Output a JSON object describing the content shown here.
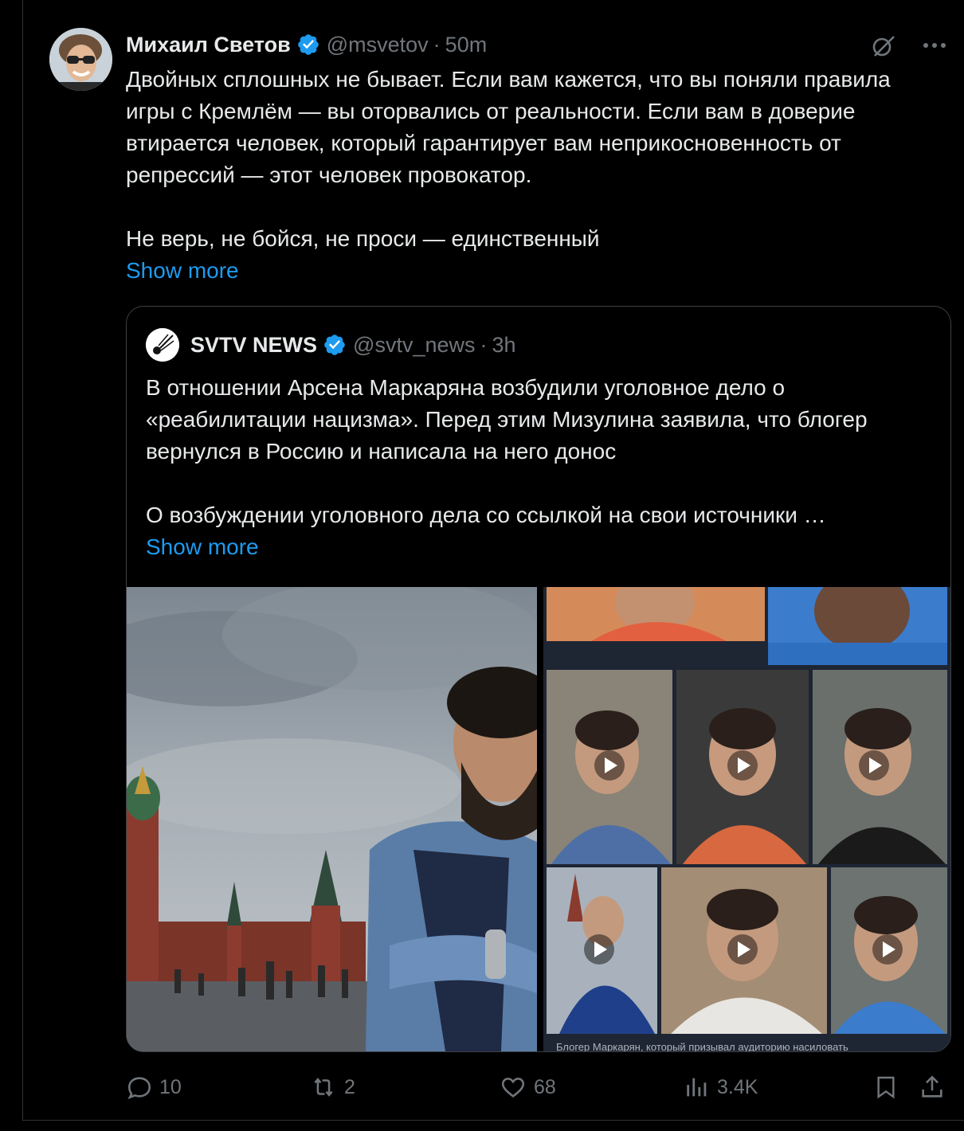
{
  "tweet": {
    "author_name": "Михаил Светов",
    "author_handle": "@msvetov",
    "separator": "·",
    "time": "50m",
    "text": "Двойных сплошных не бывает. Если вам кажется, что вы поняли правила игры с Кремлём — вы оторвались от реальности. Если вам в доверие втирается человек, который гарантирует вам неприкосновенность от репрессий — этот человек провокатор.\n\nНе верь, не бойся, не проси — единственный",
    "show_more": "Show more",
    "icons": [
      "grok-icon",
      "more-icon"
    ]
  },
  "quote": {
    "author_name": "SVTV NEWS",
    "author_handle": "@svtv_news",
    "separator": "·",
    "time": "3h",
    "text": "В отношении Арсена Маркаряна возбудили уголовное дело о «реабилитации нацизма». Перед этим Мизулина заявила, что блогер вернулся в Россию и написала на него донос\n\nО возбуждении уголовного дела со ссылкой на свои источники …",
    "show_more": "Show more",
    "collage_caption": "Блогер Маркарян, который призывал аудиторию насиловать"
  },
  "actions": {
    "replies": "10",
    "reposts": "2",
    "likes": "68",
    "views": "3.4K"
  },
  "colors": {
    "background": "#000000",
    "text": "#e7e9ea",
    "muted": "#71767b",
    "accent": "#1d9bf0",
    "border": "#2f3336"
  }
}
